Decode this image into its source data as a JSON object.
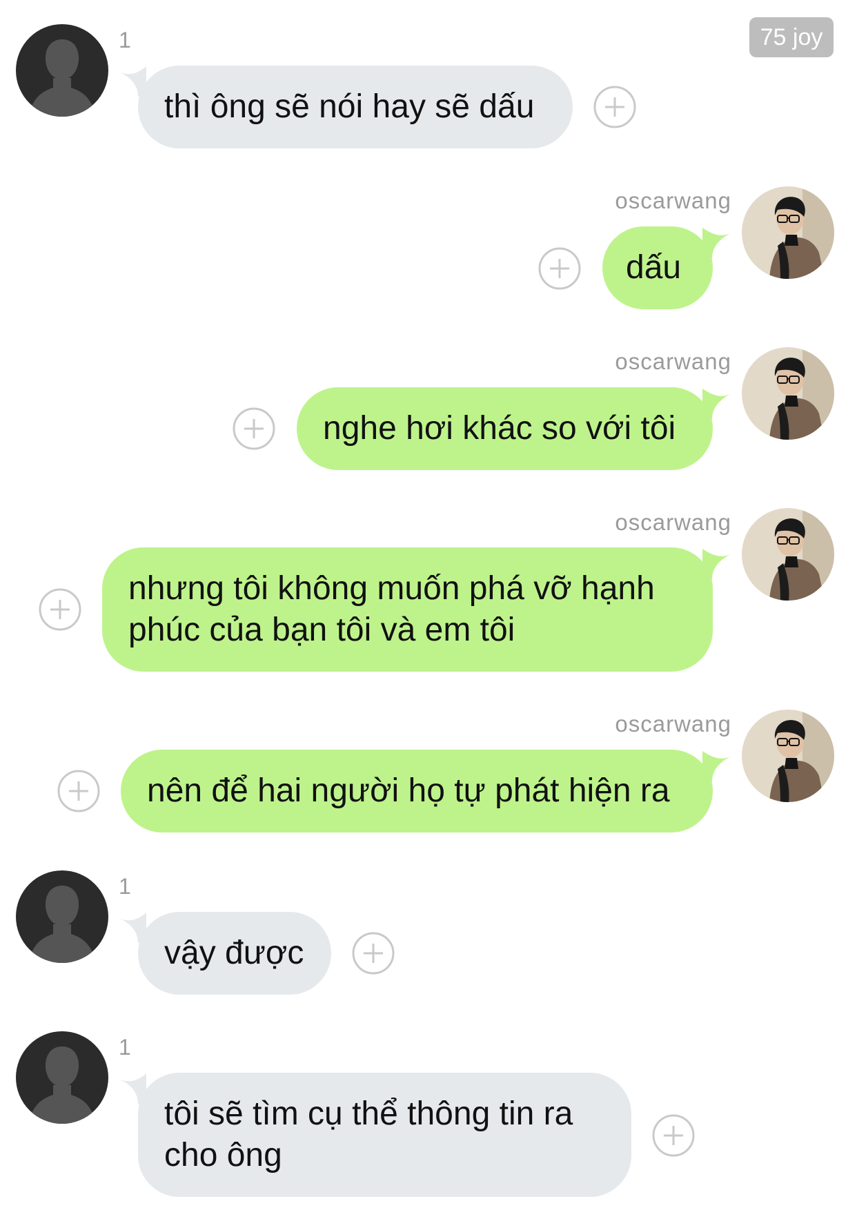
{
  "header": {
    "badge": "75 joy"
  },
  "colors": {
    "incoming_bubble": "#e6e9ec",
    "outgoing_bubble": "#bef38c",
    "meta_text": "#9a9a9a",
    "badge_bg": "#bdbdbd"
  },
  "icons": {
    "add_reaction": "plus-circle-icon",
    "default_avatar": "person-silhouette-icon",
    "profile_avatar": "profile-photo"
  },
  "messages": [
    {
      "direction": "incoming",
      "sender": "1",
      "text": "thì ông sẽ nói hay sẽ dấu"
    },
    {
      "direction": "outgoing",
      "sender": "oscarwang",
      "text": "dấu"
    },
    {
      "direction": "outgoing",
      "sender": "oscarwang",
      "text": "nghe hơi khác so với tôi"
    },
    {
      "direction": "outgoing",
      "sender": "oscarwang",
      "text_line1": "nhưng tôi không muốn phá vỡ hạnh",
      "text_line2": "phúc của bạn tôi và em tôi"
    },
    {
      "direction": "outgoing",
      "sender": "oscarwang",
      "text": "nên để hai người họ tự phát hiện ra"
    },
    {
      "direction": "incoming",
      "sender": "1",
      "text": "vậy được"
    },
    {
      "direction": "incoming",
      "sender": "1",
      "text_line1": "tôi sẽ tìm cụ thể thông tin ra",
      "text_line2": "cho ông"
    }
  ]
}
